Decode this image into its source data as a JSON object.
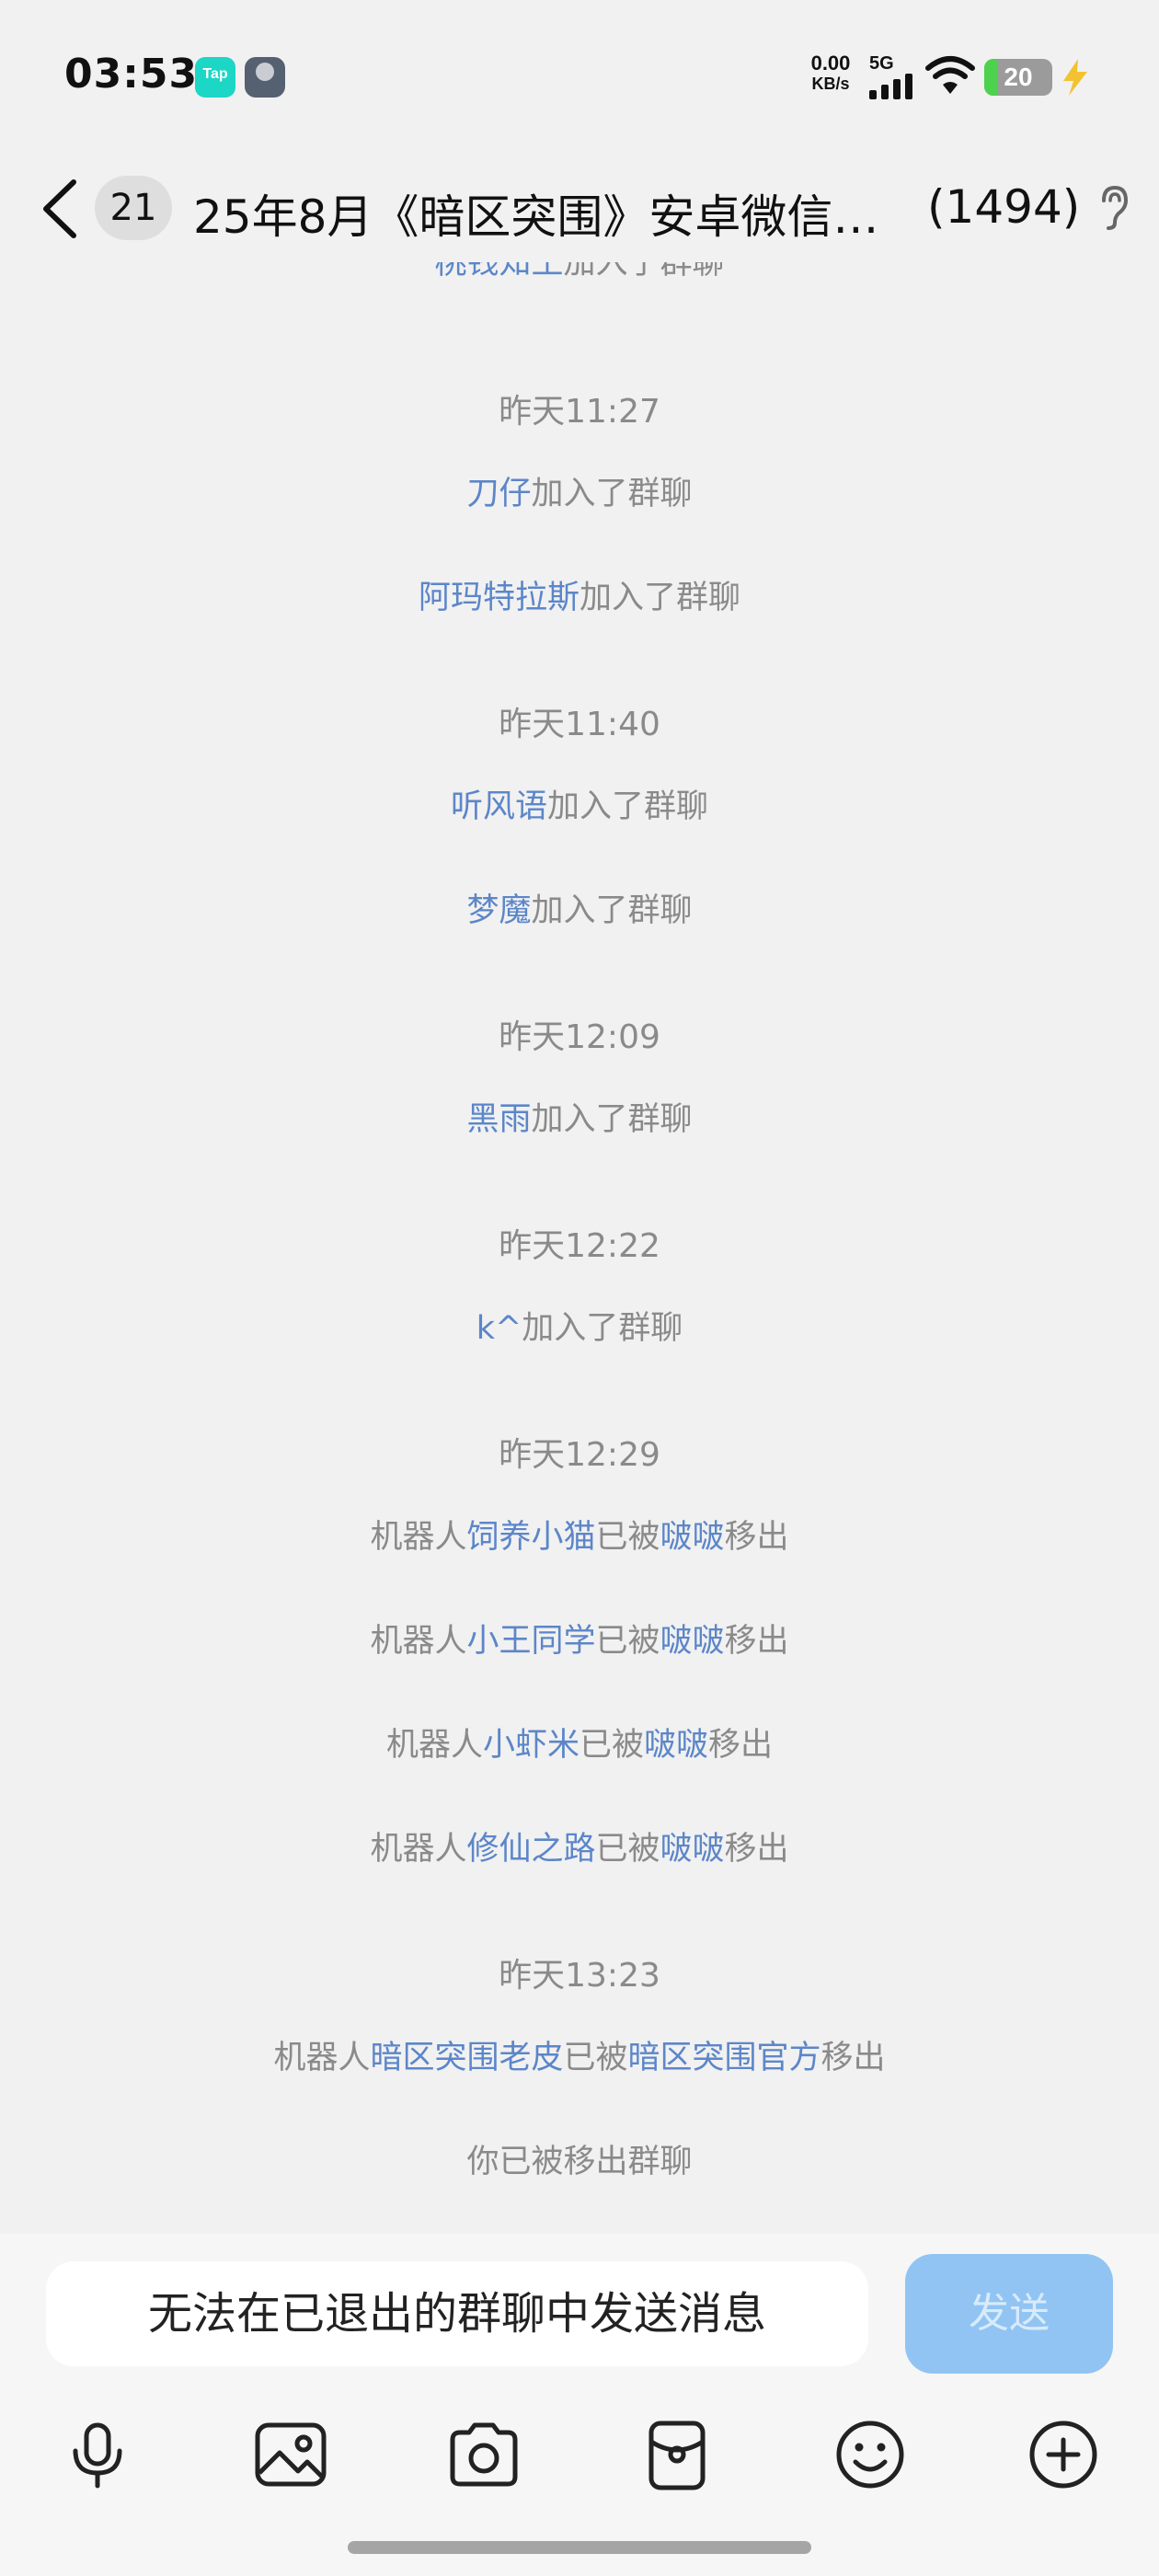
{
  "status_bar": {
    "time": "03:53",
    "app_icon_label": "Tap",
    "net_speed_value": "0.00",
    "net_speed_unit": "KB/s",
    "network": "5G",
    "battery": "20",
    "battery_level": 0.2
  },
  "header": {
    "unread_count": "21",
    "title": "25年8月《暗区突围》安卓微信…",
    "member_count": "(1494)"
  },
  "messages": [
    {
      "type": "event",
      "parts": [
        {
          "t": "桃钱知王",
          "name": true
        },
        {
          "t": "加入了群聊"
        }
      ]
    },
    {
      "type": "time",
      "text": "昨天11:27"
    },
    {
      "type": "event",
      "parts": [
        {
          "t": "刀仔",
          "name": true
        },
        {
          "t": "加入了群聊"
        }
      ]
    },
    {
      "type": "event",
      "parts": [
        {
          "t": "阿玛特拉斯",
          "name": true
        },
        {
          "t": "加入了群聊"
        }
      ]
    },
    {
      "type": "time",
      "text": "昨天11:40"
    },
    {
      "type": "event",
      "parts": [
        {
          "t": "听风语",
          "name": true
        },
        {
          "t": "加入了群聊"
        }
      ]
    },
    {
      "type": "event",
      "parts": [
        {
          "t": "梦魔",
          "name": true
        },
        {
          "t": "加入了群聊"
        }
      ]
    },
    {
      "type": "time",
      "text": "昨天12:09"
    },
    {
      "type": "event",
      "parts": [
        {
          "t": "黑雨",
          "name": true
        },
        {
          "t": "加入了群聊"
        }
      ]
    },
    {
      "type": "time",
      "text": "昨天12:22"
    },
    {
      "type": "event",
      "parts": [
        {
          "t": "k^",
          "name": true
        },
        {
          "t": "加入了群聊"
        }
      ]
    },
    {
      "type": "time",
      "text": "昨天12:29"
    },
    {
      "type": "event",
      "parts": [
        {
          "t": "机器人"
        },
        {
          "t": "饲养小猫",
          "name": true
        },
        {
          "t": "已被"
        },
        {
          "t": "啵啵",
          "name": true
        },
        {
          "t": "移出"
        }
      ]
    },
    {
      "type": "event",
      "parts": [
        {
          "t": "机器人"
        },
        {
          "t": "小王同学",
          "name": true
        },
        {
          "t": "已被"
        },
        {
          "t": "啵啵",
          "name": true
        },
        {
          "t": "移出"
        }
      ]
    },
    {
      "type": "event",
      "parts": [
        {
          "t": "机器人"
        },
        {
          "t": "小虾米",
          "name": true
        },
        {
          "t": "已被"
        },
        {
          "t": "啵啵",
          "name": true
        },
        {
          "t": "移出"
        }
      ]
    },
    {
      "type": "event",
      "parts": [
        {
          "t": "机器人"
        },
        {
          "t": "修仙之路",
          "name": true
        },
        {
          "t": "已被"
        },
        {
          "t": "啵啵",
          "name": true
        },
        {
          "t": "移出"
        }
      ]
    },
    {
      "type": "time",
      "text": "昨天13:23"
    },
    {
      "type": "event",
      "parts": [
        {
          "t": "机器人"
        },
        {
          "t": "暗区突围老皮",
          "name": true
        },
        {
          "t": "已被"
        },
        {
          "t": "暗区突围官方",
          "name": true
        },
        {
          "t": "移出"
        }
      ]
    },
    {
      "type": "event",
      "parts": [
        {
          "t": "你已被移出群聊"
        }
      ]
    }
  ],
  "input": {
    "disabled_text": "无法在已退出的群聊中发送消息",
    "send_label": "发送"
  },
  "toolbar": [
    "mic-icon",
    "image-icon",
    "camera-icon",
    "red-packet-icon",
    "emoji-icon",
    "plus-icon"
  ],
  "colors": {
    "name_link": "#5c86c9",
    "system_text": "#8a8a8a",
    "send_button": "#91c4f2",
    "background": "#f1f1f1"
  }
}
